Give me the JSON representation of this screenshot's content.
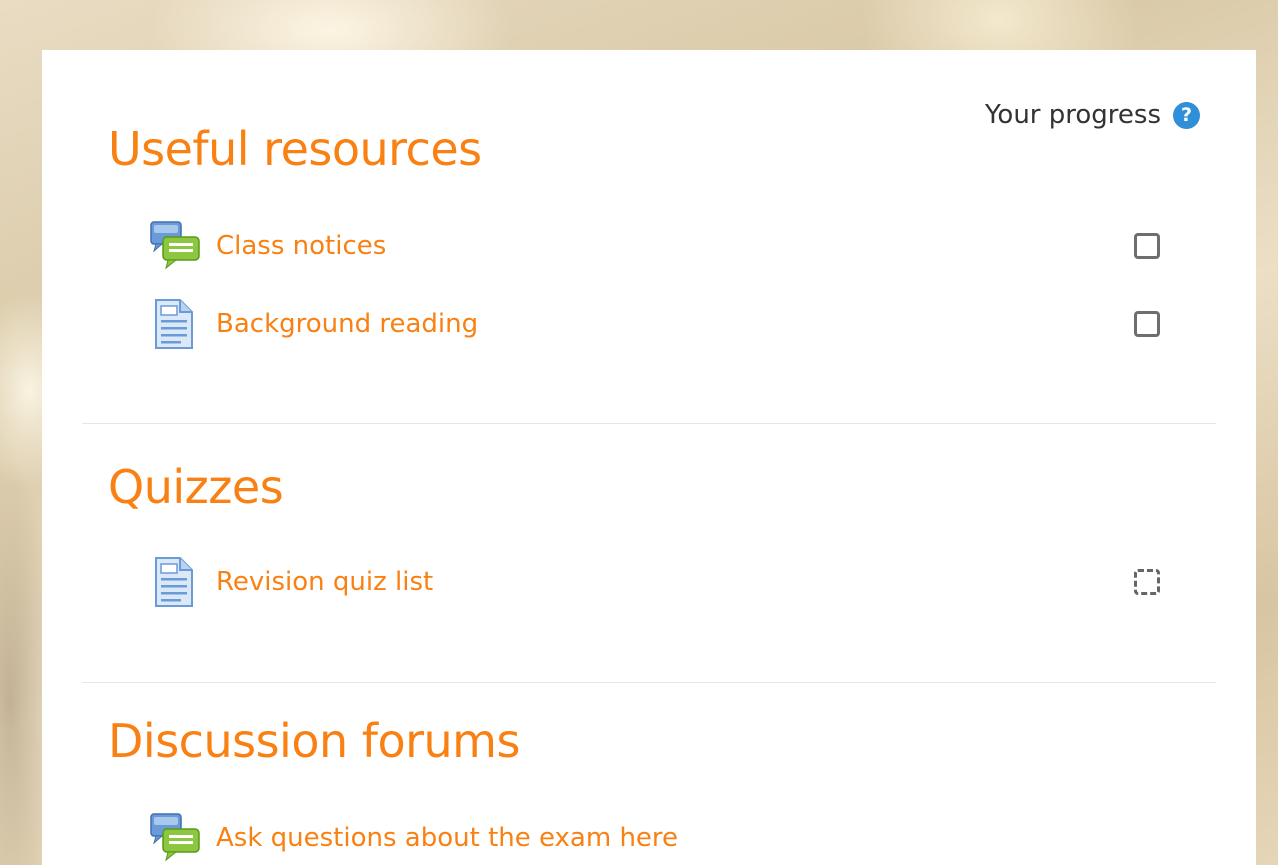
{
  "progress": {
    "label": "Your progress",
    "help_icon_glyph": "?"
  },
  "sections": [
    {
      "title": "Useful resources",
      "activities": [
        {
          "icon": "forum-icon",
          "label": "Class notices",
          "completion": "manual-incomplete"
        },
        {
          "icon": "page-icon",
          "label": "Background reading",
          "completion": "manual-incomplete"
        }
      ]
    },
    {
      "title": "Quizzes",
      "activities": [
        {
          "icon": "page-icon",
          "label": "Revision quiz list",
          "completion": "auto-incomplete"
        }
      ]
    },
    {
      "title": "Discussion forums",
      "activities": [
        {
          "icon": "forum-icon",
          "label": "Ask questions about the exam here",
          "completion": "none"
        }
      ]
    }
  ],
  "colors": {
    "accent": "#f98012",
    "help_icon": "#2f8fd8",
    "text": "#333333"
  }
}
